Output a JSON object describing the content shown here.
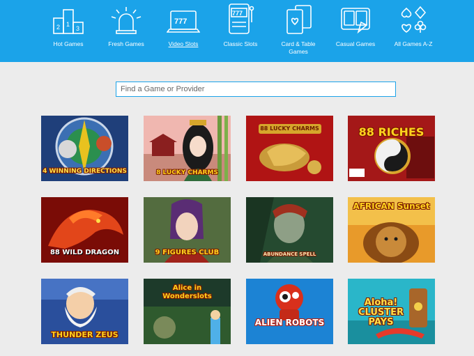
{
  "nav": {
    "items": [
      {
        "label": "Hot Games",
        "icon": "podium-icon",
        "active": false
      },
      {
        "label": "Fresh Games",
        "icon": "siren-icon",
        "active": false
      },
      {
        "label": "Video Slots",
        "icon": "laptop-slot-icon",
        "active": true
      },
      {
        "label": "Classic Slots",
        "icon": "slot-machine-icon",
        "active": false
      },
      {
        "label": "Card & Table Games",
        "icon": "playing-cards-icon",
        "active": false
      },
      {
        "label": "Casual Games",
        "icon": "casual-cards-icon",
        "active": false
      },
      {
        "label": "All Games A-Z",
        "icon": "card-suits-icon",
        "active": false
      }
    ],
    "background": "#1ba3e9"
  },
  "search": {
    "placeholder": "Find a Game or Provider",
    "value": ""
  },
  "games": [
    {
      "title": "4 WINNING DIRECTIONS"
    },
    {
      "title": "8 LUCKY CHARMS"
    },
    {
      "title": "88 LUCKY CHARMS"
    },
    {
      "title": "88 RICHES"
    },
    {
      "title": "88 WILD DRAGON"
    },
    {
      "title": "9 FIGURES CLUB"
    },
    {
      "title": "ABUNDANCE SPELL"
    },
    {
      "title": "AFRICAN Sunset"
    },
    {
      "title": "THUNDER ZEUS"
    },
    {
      "title": "Alice in Wonderslots"
    },
    {
      "title": "ALIEN ROBOTS"
    },
    {
      "title": "Aloha! CLUSTER PAYS"
    }
  ]
}
